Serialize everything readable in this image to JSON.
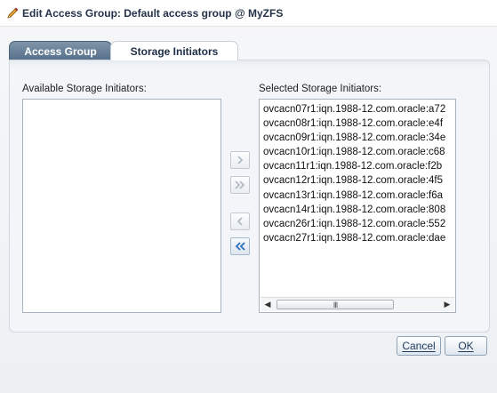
{
  "dialog": {
    "title": "Edit Access Group: Default access group @ MyZFS",
    "title_icon": "pencil-icon"
  },
  "tabs": [
    {
      "label": "Access Group",
      "active": false
    },
    {
      "label": "Storage Initiators",
      "active": true
    }
  ],
  "available": {
    "label": "Available Storage Initiators:",
    "items": []
  },
  "selected": {
    "label": "Selected Storage Initiators:",
    "items": [
      "ovcacn07r1:iqn.1988-12.com.oracle:a72",
      "ovcacn08r1:iqn.1988-12.com.oracle:e4f",
      "ovcacn09r1:iqn.1988-12.com.oracle:34e",
      "ovcacn10r1:iqn.1988-12.com.oracle:c68",
      "ovcacn11r1:iqn.1988-12.com.oracle:f2b",
      "ovcacn12r1:iqn.1988-12.com.oracle:4f5",
      "ovcacn13r1:iqn.1988-12.com.oracle:f6a",
      "ovcacn14r1:iqn.1988-12.com.oracle:808",
      "ovcacn26r1:iqn.1988-12.com.oracle:552",
      "ovcacn27r1:iqn.1988-12.com.oracle:dae"
    ],
    "scroll_thumb": "III"
  },
  "shuttle": {
    "move": "chevron-right-icon",
    "move_all": "double-chevron-right-icon",
    "remove": "chevron-left-icon",
    "remove_all": "double-chevron-left-icon"
  },
  "buttons": {
    "cancel": "Cancel",
    "ok": "OK"
  },
  "colors": {
    "inactive_tab": "#56708a",
    "accent_arrow": "#2f73c0",
    "disabled_arrow": "#b2bbc4"
  }
}
